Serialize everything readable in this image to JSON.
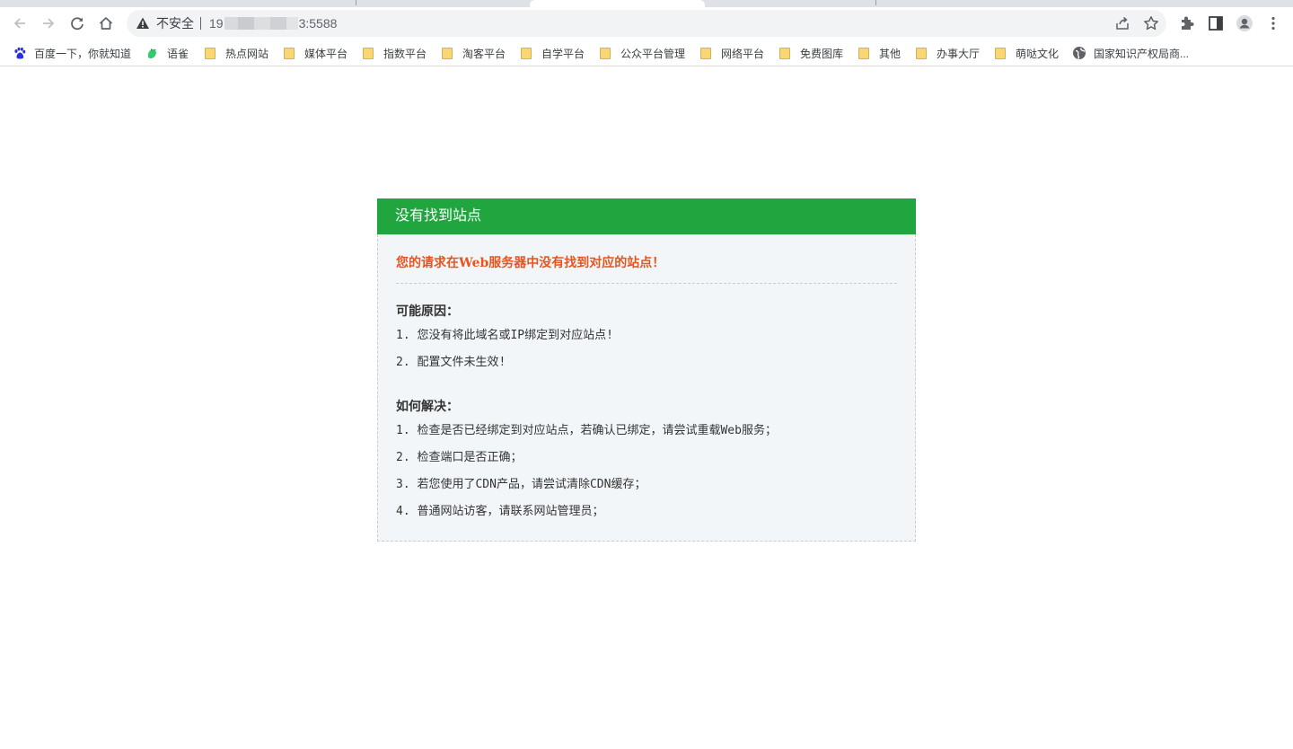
{
  "browser": {
    "omnibox": {
      "security_label": "不安全",
      "url_prefix": "19",
      "url_suffix": "3:5588"
    },
    "bookmarks": [
      {
        "label": "百度一下，你就知道",
        "icon": "baidu-paw-icon"
      },
      {
        "label": "语雀",
        "icon": "yuque-bird-icon"
      },
      {
        "label": "热点网站",
        "icon": "folder-icon"
      },
      {
        "label": "媒体平台",
        "icon": "folder-icon"
      },
      {
        "label": "指数平台",
        "icon": "folder-icon"
      },
      {
        "label": "淘客平台",
        "icon": "folder-icon"
      },
      {
        "label": "自学平台",
        "icon": "folder-icon"
      },
      {
        "label": "公众平台管理",
        "icon": "folder-icon"
      },
      {
        "label": "网络平台",
        "icon": "folder-icon"
      },
      {
        "label": "免费图库",
        "icon": "folder-icon"
      },
      {
        "label": "其他",
        "icon": "folder-icon"
      },
      {
        "label": "办事大厅",
        "icon": "folder-icon"
      },
      {
        "label": "萌哒文化",
        "icon": "folder-icon"
      },
      {
        "label": "国家知识产权局商...",
        "icon": "globe-icon"
      }
    ],
    "colors": {
      "folder": "#f8d777",
      "omnibox_bg": "#f1f3f4"
    }
  },
  "page": {
    "header_title": "没有找到站点",
    "main_message": "您的请求在Web服务器中没有找到对应的站点！",
    "reasons_title": "可能原因：",
    "reasons": [
      "1. 您没有将此域名或IP绑定到对应站点!",
      "2. 配置文件未生效!"
    ],
    "solutions_title": "如何解决：",
    "solutions": [
      "1. 检查是否已经绑定到对应站点，若确认已绑定，请尝试重载Web服务；",
      "2. 检查端口是否正确；",
      "3. 若您使用了CDN产品，请尝试清除CDN缓存；",
      "4. 普通网站访客，请联系网站管理员；"
    ],
    "colors": {
      "header_bg": "#21a63f",
      "main_message": "#e8541d",
      "body_bg": "#f3f6f9"
    }
  }
}
